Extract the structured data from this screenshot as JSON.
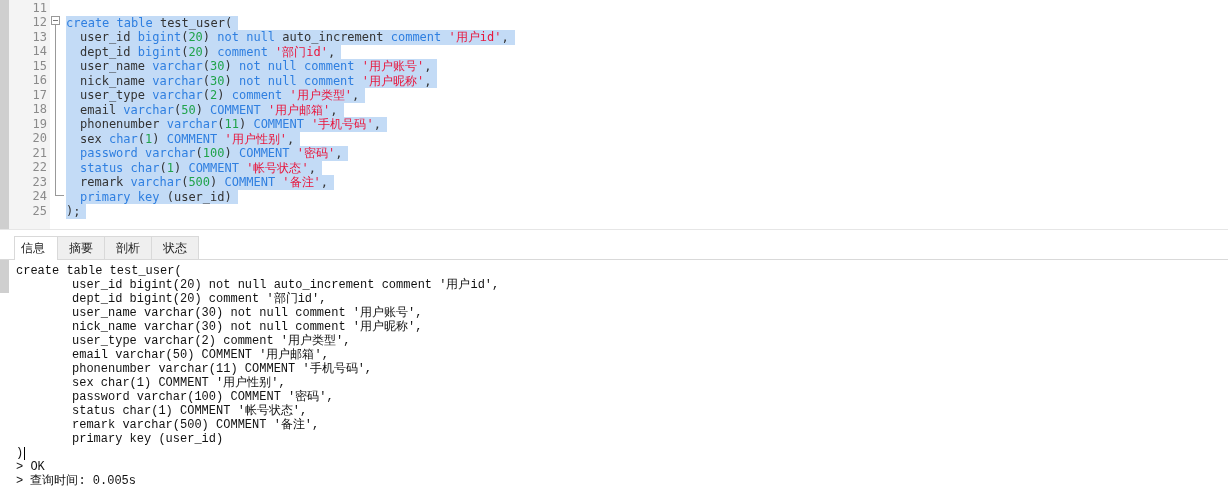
{
  "editor": {
    "lines": [
      {
        "number": "11"
      },
      {
        "number": "12",
        "selected": true,
        "indented": false,
        "tokens": [
          {
            "kind": "keyword",
            "text": "create table "
          },
          {
            "kind": "plain",
            "text": "test_user("
          }
        ]
      },
      {
        "number": "13",
        "selected": true,
        "indented": true,
        "tokens": [
          {
            "kind": "plain",
            "text": "user_id "
          },
          {
            "kind": "keyword",
            "text": "bigint"
          },
          {
            "kind": "plain",
            "text": "("
          },
          {
            "kind": "number",
            "text": "20"
          },
          {
            "kind": "plain",
            "text": ") "
          },
          {
            "kind": "keyword",
            "text": "not null "
          },
          {
            "kind": "plain",
            "text": "auto_increment "
          },
          {
            "kind": "keyword",
            "text": "comment "
          },
          {
            "kind": "string",
            "text": "'用户id'"
          },
          {
            "kind": "plain",
            "text": ","
          }
        ]
      },
      {
        "number": "14",
        "selected": true,
        "indented": true,
        "tokens": [
          {
            "kind": "plain",
            "text": "dept_id "
          },
          {
            "kind": "keyword",
            "text": "bigint"
          },
          {
            "kind": "plain",
            "text": "("
          },
          {
            "kind": "number",
            "text": "20"
          },
          {
            "kind": "plain",
            "text": ") "
          },
          {
            "kind": "keyword",
            "text": "comment "
          },
          {
            "kind": "string",
            "text": "'部门id'"
          },
          {
            "kind": "plain",
            "text": ","
          }
        ]
      },
      {
        "number": "15",
        "selected": true,
        "indented": true,
        "tokens": [
          {
            "kind": "plain",
            "text": "user_name "
          },
          {
            "kind": "keyword",
            "text": "varchar"
          },
          {
            "kind": "plain",
            "text": "("
          },
          {
            "kind": "number",
            "text": "30"
          },
          {
            "kind": "plain",
            "text": ") "
          },
          {
            "kind": "keyword",
            "text": "not null comment "
          },
          {
            "kind": "string",
            "text": "'用户账号'"
          },
          {
            "kind": "plain",
            "text": ","
          }
        ]
      },
      {
        "number": "16",
        "selected": true,
        "indented": true,
        "tokens": [
          {
            "kind": "plain",
            "text": "nick_name "
          },
          {
            "kind": "keyword",
            "text": "varchar"
          },
          {
            "kind": "plain",
            "text": "("
          },
          {
            "kind": "number",
            "text": "30"
          },
          {
            "kind": "plain",
            "text": ") "
          },
          {
            "kind": "keyword",
            "text": "not null comment "
          },
          {
            "kind": "string",
            "text": "'用户昵称'"
          },
          {
            "kind": "plain",
            "text": ","
          }
        ]
      },
      {
        "number": "17",
        "selected": true,
        "indented": true,
        "tokens": [
          {
            "kind": "plain",
            "text": "user_type "
          },
          {
            "kind": "keyword",
            "text": "varchar"
          },
          {
            "kind": "plain",
            "text": "("
          },
          {
            "kind": "number",
            "text": "2"
          },
          {
            "kind": "plain",
            "text": ") "
          },
          {
            "kind": "keyword",
            "text": "comment "
          },
          {
            "kind": "string",
            "text": "'用户类型'"
          },
          {
            "kind": "plain",
            "text": ","
          }
        ]
      },
      {
        "number": "18",
        "selected": true,
        "indented": true,
        "tokens": [
          {
            "kind": "plain",
            "text": "email "
          },
          {
            "kind": "keyword",
            "text": "varchar"
          },
          {
            "kind": "plain",
            "text": "("
          },
          {
            "kind": "number",
            "text": "50"
          },
          {
            "kind": "plain",
            "text": ") "
          },
          {
            "kind": "keyword",
            "text": "COMMENT "
          },
          {
            "kind": "string",
            "text": "'用户邮箱'"
          },
          {
            "kind": "plain",
            "text": ","
          }
        ]
      },
      {
        "number": "19",
        "selected": true,
        "indented": true,
        "tokens": [
          {
            "kind": "plain",
            "text": "phonenumber "
          },
          {
            "kind": "keyword",
            "text": "varchar"
          },
          {
            "kind": "plain",
            "text": "("
          },
          {
            "kind": "number",
            "text": "11"
          },
          {
            "kind": "plain",
            "text": ") "
          },
          {
            "kind": "keyword",
            "text": "COMMENT "
          },
          {
            "kind": "string",
            "text": "'手机号码'"
          },
          {
            "kind": "plain",
            "text": ","
          }
        ]
      },
      {
        "number": "20",
        "selected": true,
        "indented": true,
        "tokens": [
          {
            "kind": "plain",
            "text": "sex "
          },
          {
            "kind": "keyword",
            "text": "char"
          },
          {
            "kind": "plain",
            "text": "("
          },
          {
            "kind": "number",
            "text": "1"
          },
          {
            "kind": "plain",
            "text": ") "
          },
          {
            "kind": "keyword",
            "text": "COMMENT "
          },
          {
            "kind": "string",
            "text": "'用户性别'"
          },
          {
            "kind": "plain",
            "text": ","
          }
        ]
      },
      {
        "number": "21",
        "selected": true,
        "indented": true,
        "tokens": [
          {
            "kind": "keyword",
            "text": "password varchar"
          },
          {
            "kind": "plain",
            "text": "("
          },
          {
            "kind": "number",
            "text": "100"
          },
          {
            "kind": "plain",
            "text": ") "
          },
          {
            "kind": "keyword",
            "text": "COMMENT "
          },
          {
            "kind": "string",
            "text": "'密码'"
          },
          {
            "kind": "plain",
            "text": ","
          }
        ]
      },
      {
        "number": "22",
        "selected": true,
        "indented": true,
        "tokens": [
          {
            "kind": "keyword",
            "text": "status char"
          },
          {
            "kind": "plain",
            "text": "("
          },
          {
            "kind": "number",
            "text": "1"
          },
          {
            "kind": "plain",
            "text": ") "
          },
          {
            "kind": "keyword",
            "text": "COMMENT "
          },
          {
            "kind": "string",
            "text": "'帐号状态'"
          },
          {
            "kind": "plain",
            "text": ","
          }
        ]
      },
      {
        "number": "23",
        "selected": true,
        "indented": true,
        "tokens": [
          {
            "kind": "plain",
            "text": "remark "
          },
          {
            "kind": "keyword",
            "text": "varchar"
          },
          {
            "kind": "plain",
            "text": "("
          },
          {
            "kind": "number",
            "text": "500"
          },
          {
            "kind": "plain",
            "text": ") "
          },
          {
            "kind": "keyword",
            "text": "COMMENT "
          },
          {
            "kind": "string",
            "text": "'备注'"
          },
          {
            "kind": "plain",
            "text": ","
          }
        ]
      },
      {
        "number": "24",
        "selected": true,
        "indented": true,
        "tokens": [
          {
            "kind": "keyword",
            "text": "primary key "
          },
          {
            "kind": "plain",
            "text": "(user_id)"
          }
        ]
      },
      {
        "number": "25",
        "selected": true,
        "indented": false,
        "tokens": [
          {
            "kind": "plain",
            "text": ");"
          }
        ]
      }
    ]
  },
  "tabs": [
    {
      "label": "信息",
      "selected": true
    },
    {
      "label": "摘要",
      "selected": false
    },
    {
      "label": "剖析",
      "selected": false
    },
    {
      "label": "状态",
      "selected": false
    }
  ],
  "output": {
    "lines": [
      {
        "text": "create table test_user(",
        "children": [
          {
            "text": "user_id bigint(20) not null auto_increment comment '用户id',"
          },
          {
            "text": "dept_id bigint(20) comment '部门id',"
          },
          {
            "text": "user_name varchar(30) not null comment '用户账号',"
          },
          {
            "text": "nick_name varchar(30) not null comment '用户昵称',"
          },
          {
            "text": "user_type varchar(2) comment '用户类型',"
          },
          {
            "text": "email varchar(50) COMMENT '用户邮箱',"
          },
          {
            "text": "phonenumber varchar(11) COMMENT '手机号码',"
          },
          {
            "text": "sex char(1) COMMENT '用户性别',"
          },
          {
            "text": "password varchar(100) COMMENT '密码',"
          },
          {
            "text": "status char(1) COMMENT '帐号状态',"
          },
          {
            "text": "remark varchar(500) COMMENT '备注',"
          },
          {
            "text": "primary key (user_id)"
          }
        ]
      },
      {
        "text": ")",
        "cursor": true
      },
      {
        "text": "> OK"
      },
      {
        "text": "> 查询时间: 0.005s"
      }
    ]
  }
}
